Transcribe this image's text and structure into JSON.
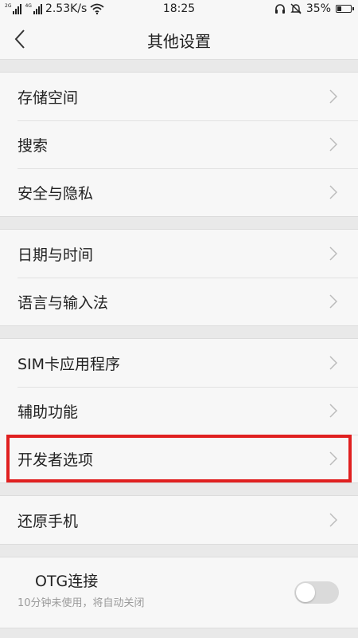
{
  "status_bar": {
    "net_label_1": "2G",
    "net_label_2": "4G",
    "speed": "2.53K/s",
    "time": "18:25",
    "battery": "35%",
    "battery_level": 0.35,
    "icons": [
      "signal-icon",
      "signal-icon",
      "wifi-icon",
      "headset-icon",
      "mute-icon",
      "battery-icon"
    ]
  },
  "navbar": {
    "title": "其他设置",
    "back_icon": "chevron-left-icon"
  },
  "groups": [
    {
      "items": [
        "存储空间",
        "搜索",
        "安全与隐私"
      ]
    },
    {
      "items": [
        "日期与时间",
        "语言与输入法"
      ]
    },
    {
      "items": [
        "SIM卡应用程序",
        "辅助功能",
        "开发者选项"
      ]
    },
    {
      "items": [
        "还原手机"
      ]
    }
  ],
  "highlighted_item": "开发者选项",
  "otg": {
    "label": "OTG连接",
    "subtitle": "10分钟未使用，将自动关闭",
    "enabled": false
  },
  "colors": {
    "highlight": "#e02020",
    "background": "#e9e9e9",
    "card": "#f7f7f7"
  }
}
